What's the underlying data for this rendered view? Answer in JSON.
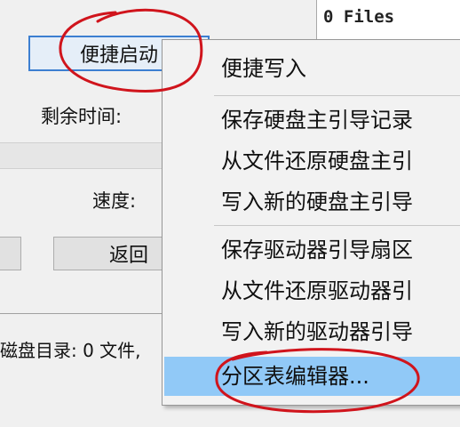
{
  "background": {
    "files_status": "0 Files",
    "quick_boot_button": "便捷启动",
    "remaining_time_label": "剩余时间:",
    "speed_label": "速度:",
    "back_button": "返回",
    "status_text": "磁盘目录: 0 文件,"
  },
  "menu": {
    "items": [
      {
        "label": "便捷写入"
      },
      {
        "label": "保存硬盘主引导记录"
      },
      {
        "label": "从文件还原硬盘主引"
      },
      {
        "label": "写入新的硬盘主引导"
      },
      {
        "label": "保存驱动器引导扇区"
      },
      {
        "label": "从文件还原驱动器引"
      },
      {
        "label": "写入新的驱动器引导"
      },
      {
        "label": "分区表编辑器..."
      }
    ],
    "highlight_color": "#91c9f7"
  },
  "annotation_color": "#d0141c"
}
